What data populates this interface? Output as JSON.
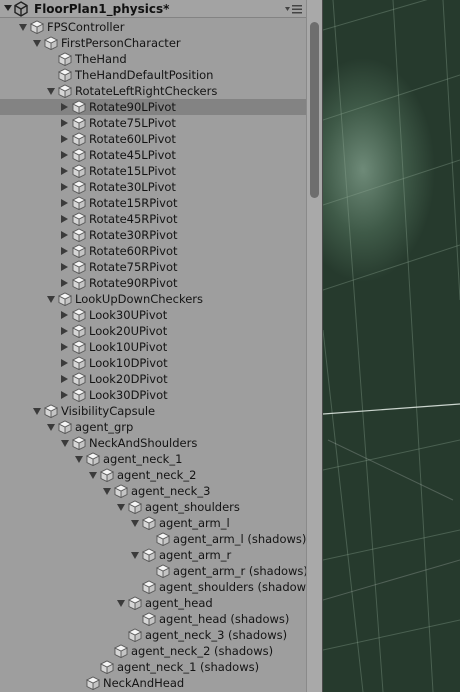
{
  "hierarchy": {
    "scene_title": "FloorPlan1_physics*",
    "rows": [
      {
        "label": "FPSController",
        "depth": 1,
        "expand": "open",
        "selected": false
      },
      {
        "label": "FirstPersonCharacter",
        "depth": 2,
        "expand": "open",
        "selected": false
      },
      {
        "label": "TheHand",
        "depth": 3,
        "expand": "none",
        "selected": false
      },
      {
        "label": "TheHandDefaultPosition",
        "depth": 3,
        "expand": "none",
        "selected": false
      },
      {
        "label": "RotateLeftRightCheckers",
        "depth": 3,
        "expand": "open",
        "selected": false
      },
      {
        "label": "Rotate90LPivot",
        "depth": 4,
        "expand": "closed",
        "selected": true
      },
      {
        "label": "Rotate75LPivot",
        "depth": 4,
        "expand": "closed",
        "selected": false
      },
      {
        "label": "Rotate60LPivot",
        "depth": 4,
        "expand": "closed",
        "selected": false
      },
      {
        "label": "Rotate45LPivot",
        "depth": 4,
        "expand": "closed",
        "selected": false
      },
      {
        "label": "Rotate15LPivot",
        "depth": 4,
        "expand": "closed",
        "selected": false
      },
      {
        "label": "Rotate30LPivot",
        "depth": 4,
        "expand": "closed",
        "selected": false
      },
      {
        "label": "Rotate15RPivot",
        "depth": 4,
        "expand": "closed",
        "selected": false
      },
      {
        "label": "Rotate45RPivot",
        "depth": 4,
        "expand": "closed",
        "selected": false
      },
      {
        "label": "Rotate30RPivot",
        "depth": 4,
        "expand": "closed",
        "selected": false
      },
      {
        "label": "Rotate60RPivot",
        "depth": 4,
        "expand": "closed",
        "selected": false
      },
      {
        "label": "Rotate75RPivot",
        "depth": 4,
        "expand": "closed",
        "selected": false
      },
      {
        "label": "Rotate90RPivot",
        "depth": 4,
        "expand": "closed",
        "selected": false
      },
      {
        "label": "LookUpDownCheckers",
        "depth": 3,
        "expand": "open",
        "selected": false
      },
      {
        "label": "Look30UPivot",
        "depth": 4,
        "expand": "closed",
        "selected": false
      },
      {
        "label": "Look20UPivot",
        "depth": 4,
        "expand": "closed",
        "selected": false
      },
      {
        "label": "Look10UPivot",
        "depth": 4,
        "expand": "closed",
        "selected": false
      },
      {
        "label": "Look10DPivot",
        "depth": 4,
        "expand": "closed",
        "selected": false
      },
      {
        "label": "Look20DPivot",
        "depth": 4,
        "expand": "closed",
        "selected": false
      },
      {
        "label": "Look30DPivot",
        "depth": 4,
        "expand": "closed",
        "selected": false
      },
      {
        "label": "VisibilityCapsule",
        "depth": 2,
        "expand": "open",
        "selected": false
      },
      {
        "label": "agent_grp",
        "depth": 3,
        "expand": "open",
        "selected": false
      },
      {
        "label": "NeckAndShoulders",
        "depth": 4,
        "expand": "open",
        "selected": false
      },
      {
        "label": "agent_neck_1",
        "depth": 5,
        "expand": "open",
        "selected": false
      },
      {
        "label": "agent_neck_2",
        "depth": 6,
        "expand": "open",
        "selected": false
      },
      {
        "label": "agent_neck_3",
        "depth": 7,
        "expand": "open",
        "selected": false
      },
      {
        "label": "agent_shoulders",
        "depth": 8,
        "expand": "open",
        "selected": false
      },
      {
        "label": "agent_arm_l",
        "depth": 9,
        "expand": "open",
        "selected": false
      },
      {
        "label": "agent_arm_l (shadows)",
        "depth": 10,
        "expand": "none",
        "selected": false
      },
      {
        "label": "agent_arm_r",
        "depth": 9,
        "expand": "open",
        "selected": false
      },
      {
        "label": "agent_arm_r (shadows)",
        "depth": 10,
        "expand": "none",
        "selected": false
      },
      {
        "label": "agent_shoulders (shadows)",
        "depth": 9,
        "expand": "none",
        "selected": false
      },
      {
        "label": "agent_head",
        "depth": 8,
        "expand": "open",
        "selected": false
      },
      {
        "label": "agent_head (shadows)",
        "depth": 9,
        "expand": "none",
        "selected": false
      },
      {
        "label": "agent_neck_3 (shadows)",
        "depth": 8,
        "expand": "none",
        "selected": false
      },
      {
        "label": "agent_neck_2 (shadows)",
        "depth": 7,
        "expand": "none",
        "selected": false
      },
      {
        "label": "agent_neck_1 (shadows)",
        "depth": 6,
        "expand": "none",
        "selected": false
      },
      {
        "label": "NeckAndHead",
        "depth": 5,
        "expand": "none",
        "selected": false
      }
    ]
  },
  "icons": {
    "scene": "unity-logo-icon",
    "object": "gameobject-cube-icon",
    "menu": "panel-menu-icon"
  },
  "colors": {
    "panel_bg": "#9e9e9e",
    "selected_row": "#838383",
    "viewport_green": "#2b3a30"
  }
}
